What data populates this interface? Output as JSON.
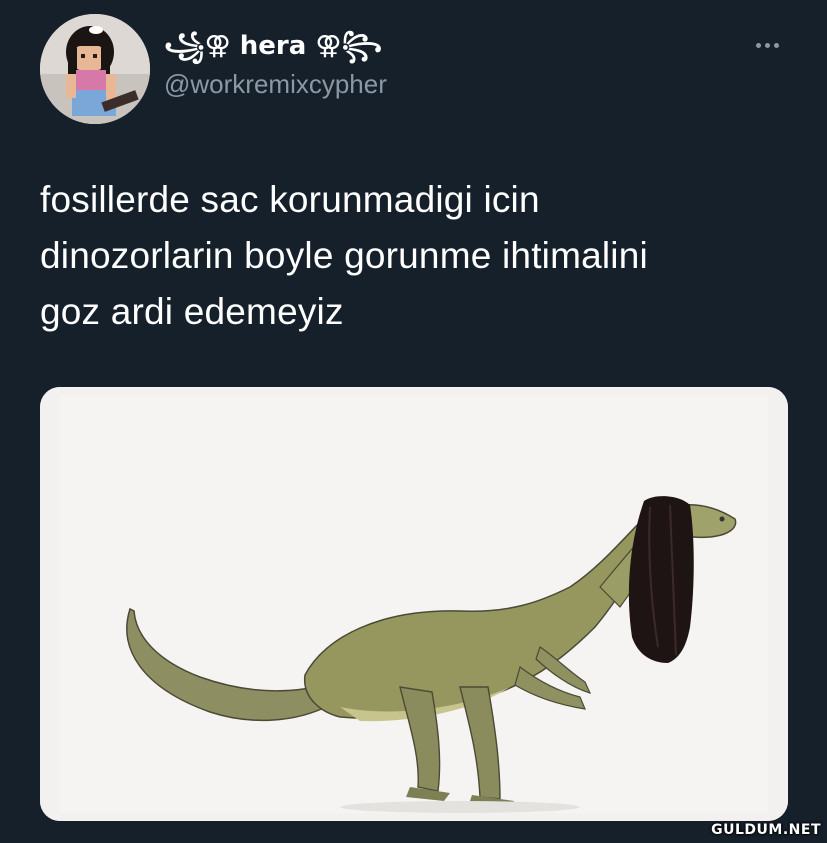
{
  "user": {
    "display_name": "꧁⚢ hera ⚢꧂",
    "handle": "@workremixcypher"
  },
  "tweet": {
    "text_lines": [
      "fosillerde sac korunmadigi icin",
      "dinozorlarin boyle gorunme ihtimalini",
      "goz ardi edemeyiz"
    ]
  },
  "media": {
    "icon": "dinosaur-with-long-hair",
    "background_color": "#f3f3f3"
  },
  "watermark": "GULDUM.NET",
  "colors": {
    "background": "#15202b",
    "text": "#ffffff",
    "secondary": "#8b98a5"
  }
}
